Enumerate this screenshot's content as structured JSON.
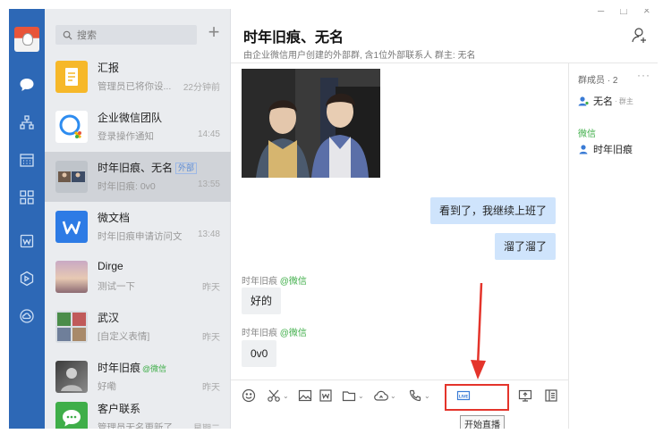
{
  "window": {
    "minimize": "–",
    "maximize": "□",
    "close": "×"
  },
  "search": {
    "placeholder": "搜索"
  },
  "new_button": "+",
  "conversations": [
    {
      "title": "汇报",
      "subtitle": "管理员已将你设...",
      "time": "22分钟前"
    },
    {
      "title": "企业微信团队",
      "subtitle": "登录操作通知",
      "time": "14:45"
    },
    {
      "title": "时年旧痕、无名",
      "tag": "外部",
      "subtitle": "时年旧痕: 0v0",
      "time": "13:55"
    },
    {
      "title": "微文档",
      "subtitle": "时年旧痕申请访问文...",
      "time": "13:48"
    },
    {
      "title": "Dirge",
      "subtitle": "测试一下",
      "time": "昨天"
    },
    {
      "title": "武汉",
      "subtitle": "[自定义表情]",
      "time": "昨天"
    },
    {
      "title": "时年旧痕",
      "tag_wechat": "@微信",
      "subtitle": "好嘞",
      "time": "昨天"
    },
    {
      "title": "客户联系",
      "subtitle": "管理员无名更新了...",
      "time": "星期二"
    }
  ],
  "chat": {
    "title": "时年旧痕、无名",
    "subtitle": "由企业微信用户创建的外部群, 含1位外部联系人 群主: 无名",
    "messages": [
      {
        "side": "right",
        "text": "看到了，我继续上班了"
      },
      {
        "side": "right",
        "text": "溜了溜了"
      },
      {
        "side": "left",
        "sender": "时年旧痕",
        "sender_tag": "@微信",
        "text": "好的"
      },
      {
        "side": "left",
        "sender": "时年旧痕",
        "sender_tag": "@微信",
        "text": "0v0"
      }
    ],
    "tooltip": "开始直播"
  },
  "members": {
    "title": "群成员 · 2",
    "more": "···",
    "owner": {
      "name": "无名",
      "role": "· 群主"
    },
    "group_label": "微信",
    "member": {
      "name": "时年旧痕"
    }
  },
  "colors": {
    "rail": "#2d68b6",
    "bubble_self": "#cfe4fc",
    "wechat_green": "#3fae49",
    "highlight_red": "#e4342b"
  }
}
